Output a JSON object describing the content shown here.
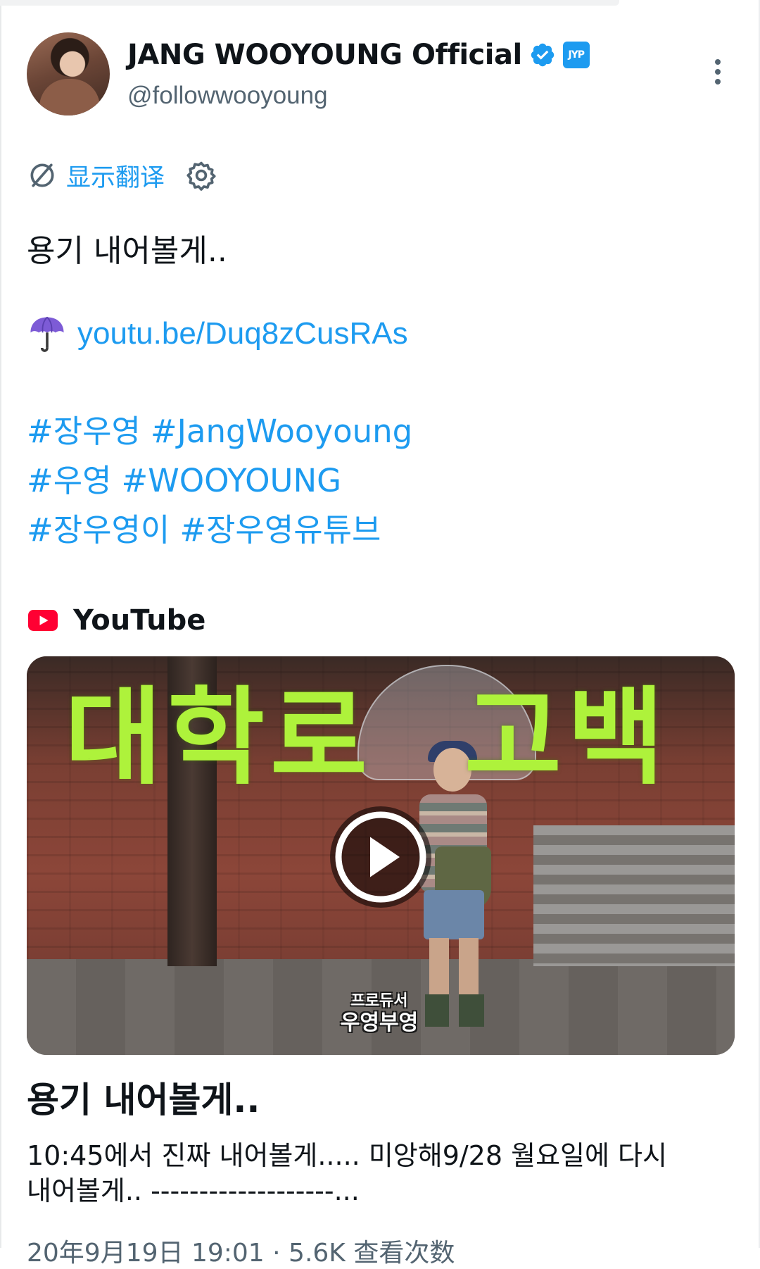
{
  "author": {
    "display_name": "JANG WOOYOUNG Official",
    "handle": "@followwooyoung",
    "affiliate_badge": "JYP"
  },
  "translate": {
    "label": "显示翻译"
  },
  "tweet": {
    "text": "용기 내어볼게..",
    "link_emoji": "umbrella-icon",
    "link": "youtu.be/Duq8zCusRAs",
    "hashtag_lines": [
      [
        "#장우영",
        "#JangWooyoung"
      ],
      [
        "#우영",
        "#WOOYOUNG"
      ],
      [
        "#장우영이",
        "#장우영유튜브"
      ]
    ]
  },
  "card": {
    "source": "YouTube",
    "thumbnail_text_left": "대학로",
    "thumbnail_text_right": "고백",
    "thumbnail_logo_line1": "프로듀서",
    "thumbnail_logo_line2": "우영부영",
    "title": "용기 내어볼게..",
    "description_line1": "10:45에서 진짜 내어볼게..... 미앙해9/28 월요일에 다시",
    "description_line2": "내어볼게.. -------------------..."
  },
  "meta": {
    "partial": "20年9月19日 19:01 · 5.6K 查看次数"
  },
  "colors": {
    "accent": "#1d9bf0",
    "text": "#0f1419",
    "secondary": "#536471",
    "youtube_red": "#ff0033",
    "thumbnail_title": "#aef23b"
  }
}
